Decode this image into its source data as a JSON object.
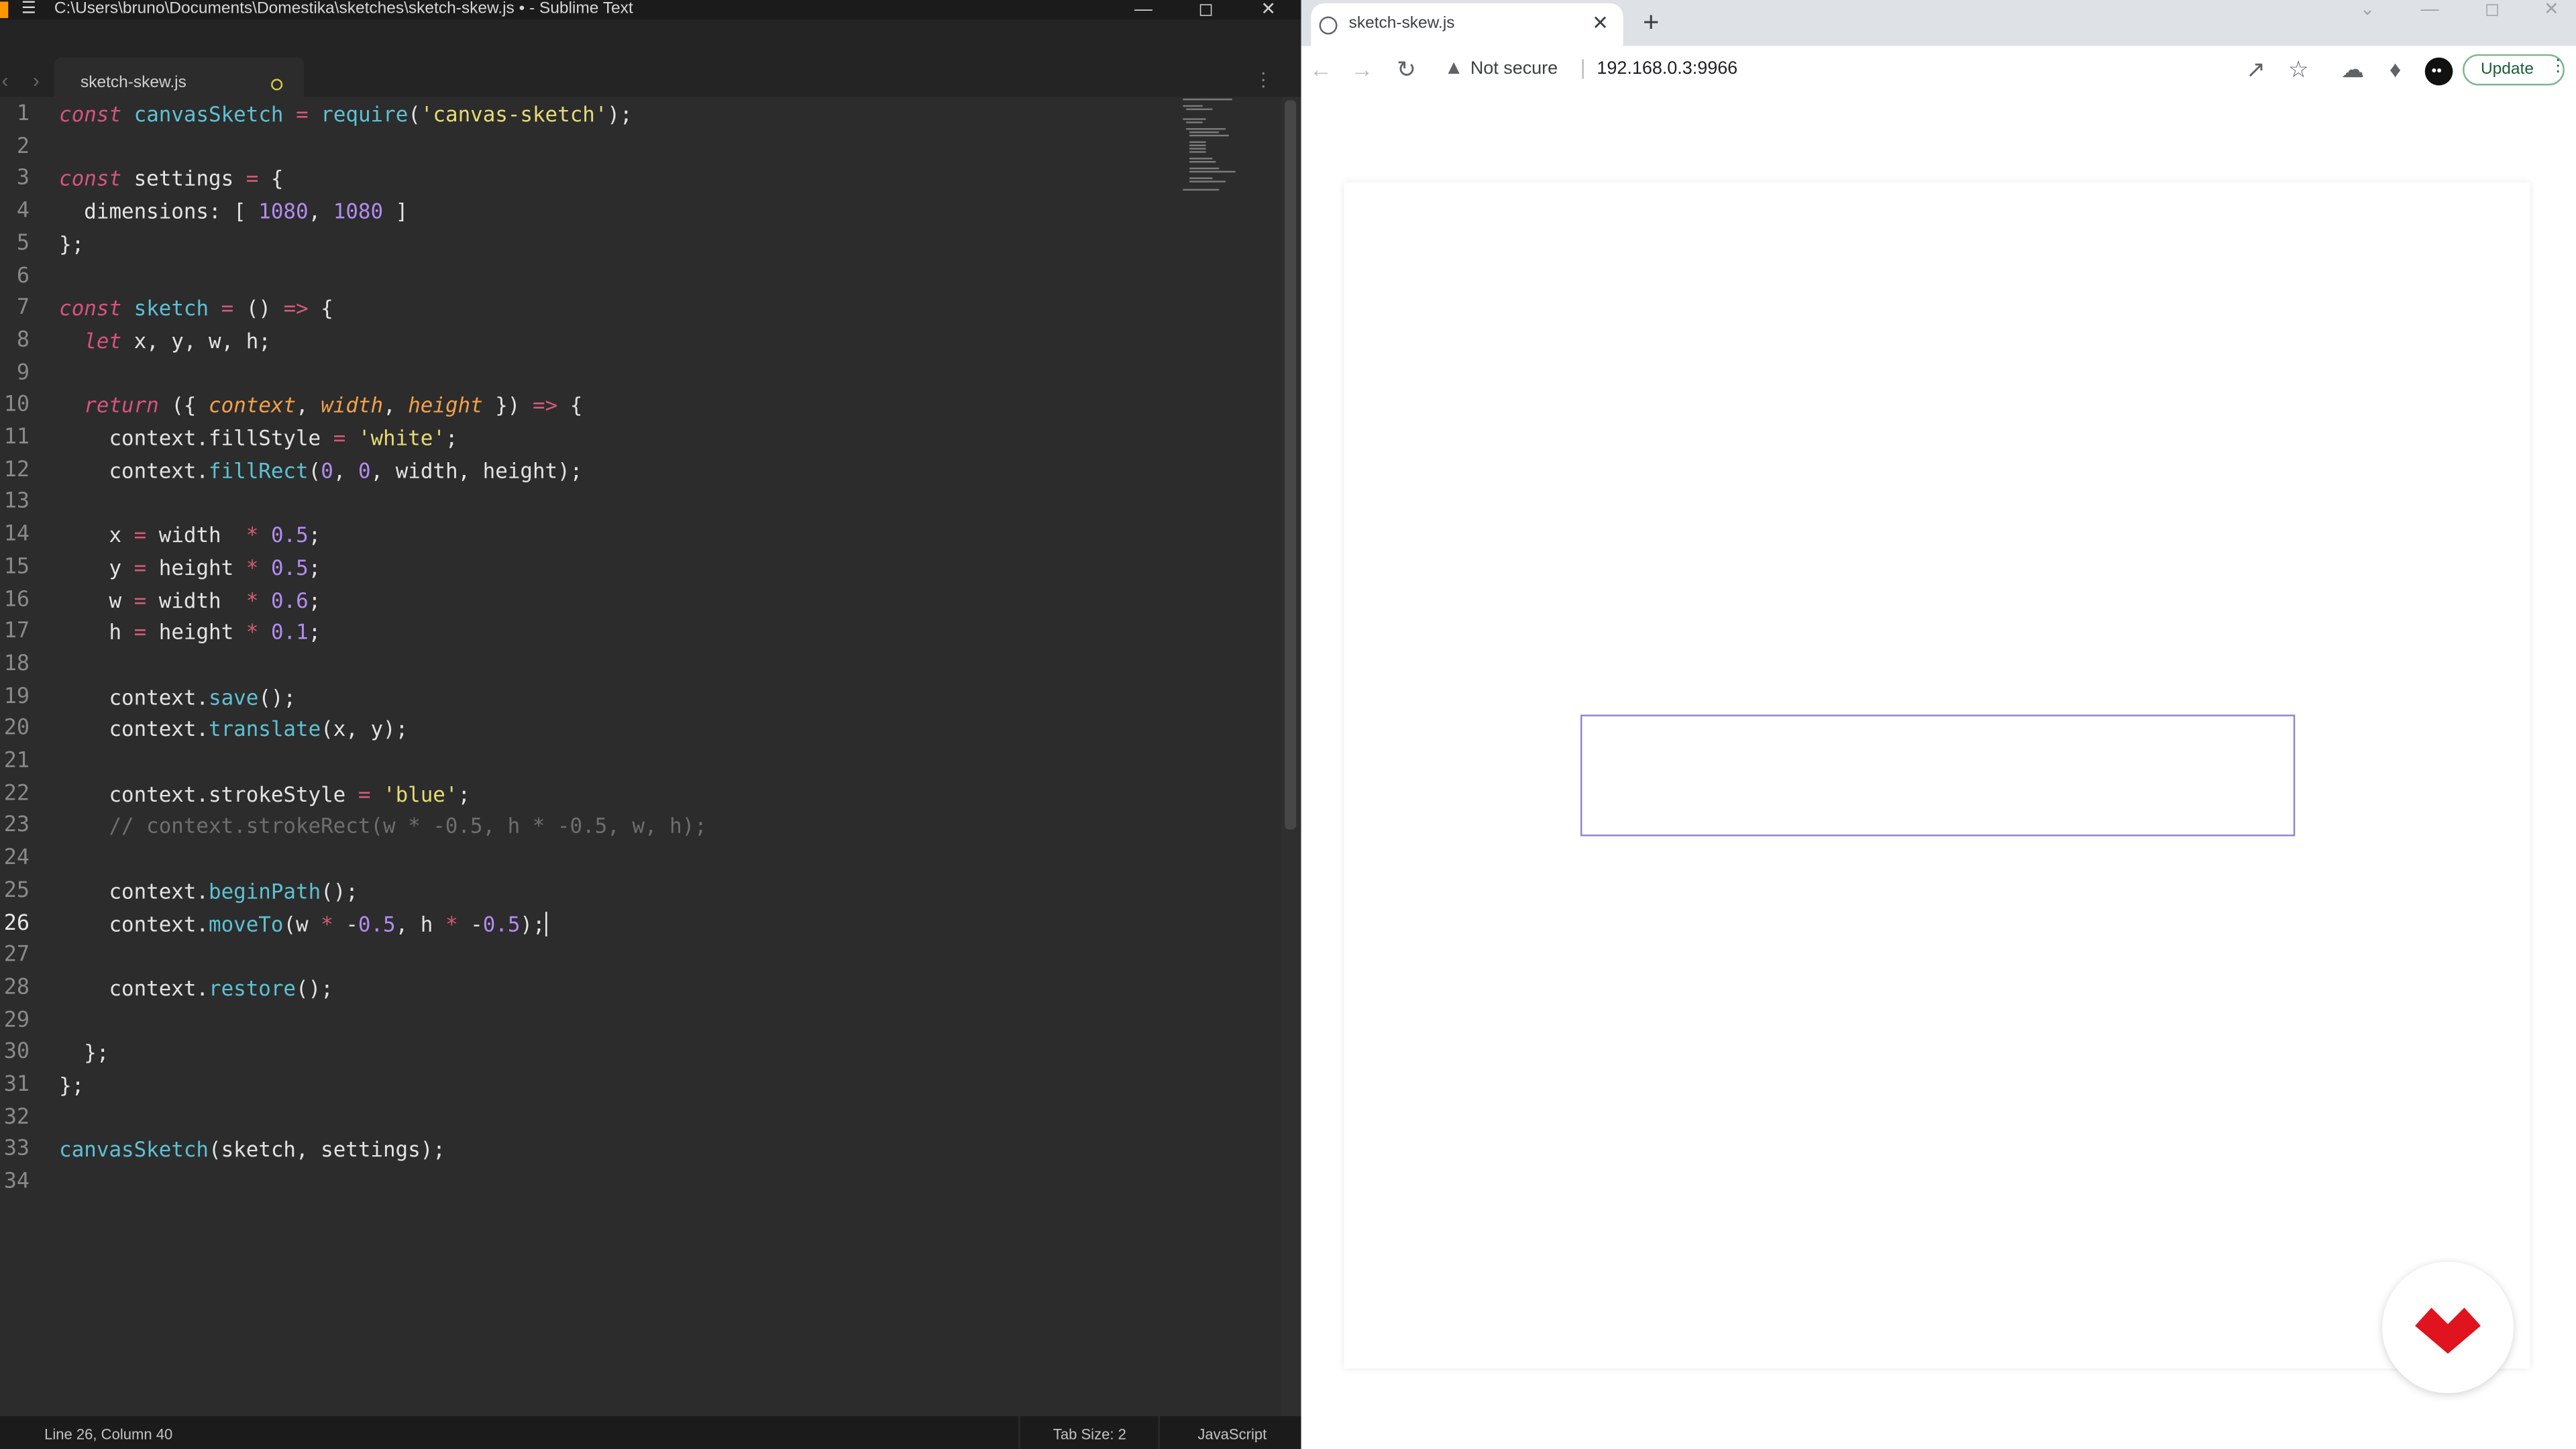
{
  "sublime": {
    "window_title": "C:\\Users\\bruno\\Documents\\Domestika\\sketches\\sketch-skew.js • - Sublime Text",
    "menu_icon": "hamburger-icon",
    "tab": {
      "label": "sketch-skew.js",
      "dirty": true
    },
    "active_line": 26,
    "code_lines": [
      "const canvasSketch = require('canvas-sketch');",
      "",
      "const settings = {",
      "  dimensions: [ 1080, 1080 ]",
      "};",
      "",
      "const sketch = () => {",
      "  let x, y, w, h;",
      "",
      "  return ({ context, width, height }) => {",
      "    context.fillStyle = 'white';",
      "    context.fillRect(0, 0, width, height);",
      "",
      "    x = width  * 0.5;",
      "    y = height * 0.5;",
      "    w = width  * 0.6;",
      "    h = height * 0.1;",
      "",
      "    context.save();",
      "    context.translate(x, y);",
      "",
      "    context.strokeStyle = 'blue';",
      "    // context.strokeRect(w * -0.5, h * -0.5, w, h);",
      "",
      "    context.beginPath();",
      "    context.moveTo(w * -0.5, h * -0.5);",
      "",
      "    context.restore();",
      "",
      "  };",
      "};",
      "",
      "canvasSketch(sketch, settings);",
      ""
    ],
    "status": {
      "position": "Line 26, Column 40",
      "tab_size": "Tab Size: 2",
      "syntax": "JavaScript"
    }
  },
  "chrome": {
    "tab_title": "sketch-skew.js",
    "security_label": "Not secure",
    "url": "192.168.0.3:9966",
    "update_label": "Update",
    "page": {
      "background": "#ffffff",
      "stroke_color": "#8b84d7",
      "badge_color": "#e0141e"
    }
  },
  "colors": {
    "editor_bg": "#2c2c2c",
    "keyword": "#d7537e",
    "function": "#5ec1d4",
    "string": "#e6db74",
    "number": "#b38cf0",
    "param": "#f3a14c"
  }
}
